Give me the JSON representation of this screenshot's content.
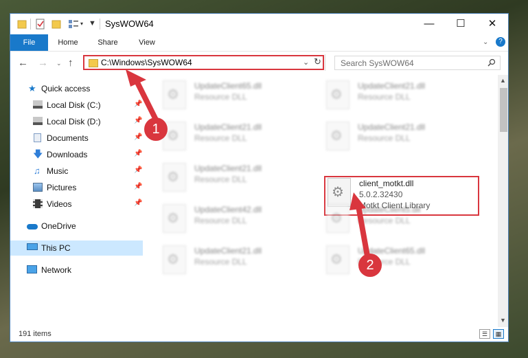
{
  "window": {
    "title": "SysWOW64",
    "controls": {
      "minimize": "—",
      "maximize": "☐",
      "close": "✕"
    }
  },
  "ribbon": {
    "tabs": [
      {
        "label": "File"
      },
      {
        "label": "Home"
      },
      {
        "label": "Share"
      },
      {
        "label": "View"
      }
    ],
    "expand_icon": "chevron-down-icon",
    "help_icon": "?"
  },
  "nav": {
    "address": "C:\\Windows\\SysWOW64",
    "search_placeholder": "Search SysWOW64"
  },
  "sidebar": {
    "items": [
      {
        "label": "Quick access",
        "icon": "star-icon"
      },
      {
        "label": "Local Disk (C:)",
        "icon": "drive-icon",
        "pinned": true
      },
      {
        "label": "Local Disk (D:)",
        "icon": "drive-icon",
        "pinned": true
      },
      {
        "label": "Documents",
        "icon": "documents-icon",
        "pinned": true
      },
      {
        "label": "Downloads",
        "icon": "download-icon",
        "pinned": true
      },
      {
        "label": "Music",
        "icon": "music-icon",
        "pinned": true
      },
      {
        "label": "Pictures",
        "icon": "pictures-icon",
        "pinned": true
      },
      {
        "label": "Videos",
        "icon": "videos-icon",
        "pinned": true
      },
      {
        "label": "OneDrive",
        "icon": "cloud-icon"
      },
      {
        "label": "This PC",
        "icon": "computer-icon",
        "selected": true
      },
      {
        "label": "Network",
        "icon": "network-icon"
      }
    ]
  },
  "files": {
    "left": [
      {
        "name": "UpdateClient65.dll",
        "desc": "Resource DLL"
      },
      {
        "name": "UpdateClient21.dll",
        "desc": "Resource DLL"
      },
      {
        "name": "UpdateClient21.dll",
        "desc": "Resource DLL"
      },
      {
        "name": "UpdateClient42.dll",
        "desc": "Resource DLL"
      },
      {
        "name": "UpdateClient21.dll",
        "desc": "Resource DLL"
      }
    ],
    "right": [
      {
        "name": "UpdateClient21.dll",
        "desc": "Resource DLL"
      },
      {
        "name": "UpdateClient21.dll",
        "desc": "Resource DLL"
      },
      {
        "name": "UpdateClient5.dll",
        "desc": "Resource DLL"
      },
      {
        "name": "UpdateClient65.dll",
        "desc": "Resource DLL"
      }
    ],
    "highlighted": {
      "name": "client_motkt.dll",
      "version": "5.0.2.32430",
      "desc": "Motkt Client Library"
    }
  },
  "status": {
    "items": "191 items"
  },
  "callouts": {
    "one": "1",
    "two": "2"
  },
  "colors": {
    "accent": "#1979ca",
    "highlight": "#d9363e",
    "selected": "#cce8ff"
  }
}
